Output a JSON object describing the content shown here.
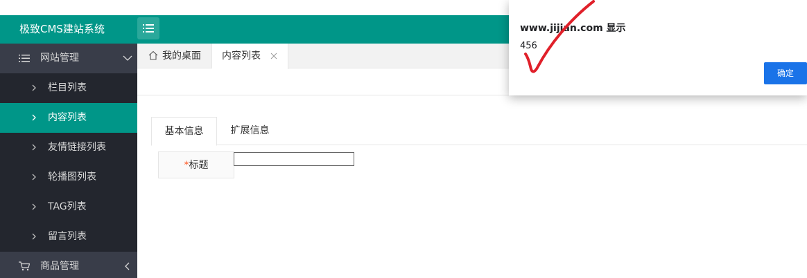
{
  "app": {
    "title": "极致CMS建站系统"
  },
  "sidebar": {
    "group1": {
      "label": "网站管理"
    },
    "items": [
      {
        "label": "栏目列表"
      },
      {
        "label": "内容列表",
        "active": true
      },
      {
        "label": "友情链接列表"
      },
      {
        "label": "轮播图列表"
      },
      {
        "label": "TAG列表"
      },
      {
        "label": "留言列表"
      }
    ],
    "group2": {
      "label": "商品管理"
    }
  },
  "tabs": {
    "home": "我的桌面",
    "content": "内容列表"
  },
  "form": {
    "tabs": [
      "基本信息",
      "扩展信息"
    ],
    "title_required_mark": "*",
    "title_label": "标题",
    "title_value": ""
  },
  "dialog": {
    "title": "www.jijian.com 显示",
    "message": "456",
    "ok_label": "确定"
  },
  "colors": {
    "accent": "#009688",
    "sidebar_bg": "#23262e",
    "sidebar_group_bg": "#393d49",
    "dialog_button": "#1a73e8",
    "annotation_check": "#e0202a"
  }
}
